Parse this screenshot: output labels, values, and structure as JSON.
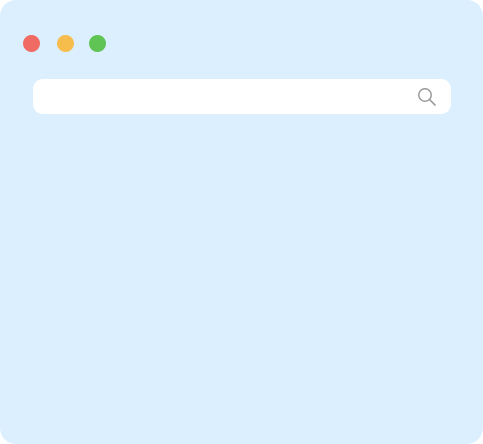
{
  "window": {
    "background": "#dbeffe"
  },
  "traffic_lights": {
    "close_color": "#f06b63",
    "minimize_color": "#f6bd4d",
    "maximize_color": "#5fc454"
  },
  "search": {
    "value": "",
    "placeholder": "",
    "icon": "search-icon",
    "icon_color": "#9a9a9a"
  }
}
